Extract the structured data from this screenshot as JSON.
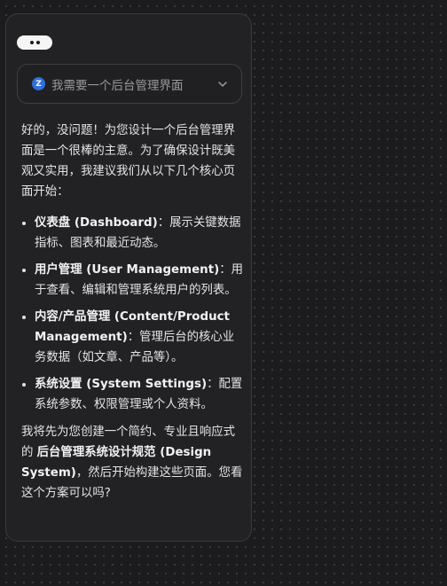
{
  "typing_indicator": {
    "dots": 2
  },
  "prompt": {
    "avatar_letter": "Z",
    "text": "我需要一个后台管理界面"
  },
  "reply": {
    "intro": "好的，没问题！为您设计一个后台管理界面是一个很棒的主意。为了确保设计既美观又实用，我建议我们从以下几个核心页面开始：",
    "items": [
      {
        "title": "仪表盘 (Dashboard)",
        "desc": "：展示关键数据指标、图表和最近动态。"
      },
      {
        "title": "用户管理 (User Management)",
        "desc": "：用于查看、编辑和管理系统用户的列表。"
      },
      {
        "title": "内容/产品管理 (Content/Product Management)",
        "desc": "：管理后台的核心业务数据（如文章、产品等）。"
      },
      {
        "title": "系统设置 (System Settings)",
        "desc": "：配置系统参数、权限管理或个人资料。"
      }
    ],
    "closing_pre": "我将先为您创建一个简约、专业且响应式的 ",
    "closing_bold": "后台管理系统设计规范 (Design System)",
    "closing_post": "，然后开始构建这些页面。您看这个方案可以吗?"
  },
  "colors": {
    "background": "#1c1c1e",
    "panel": "#222224",
    "avatar_badge": "#2f6fe0"
  }
}
